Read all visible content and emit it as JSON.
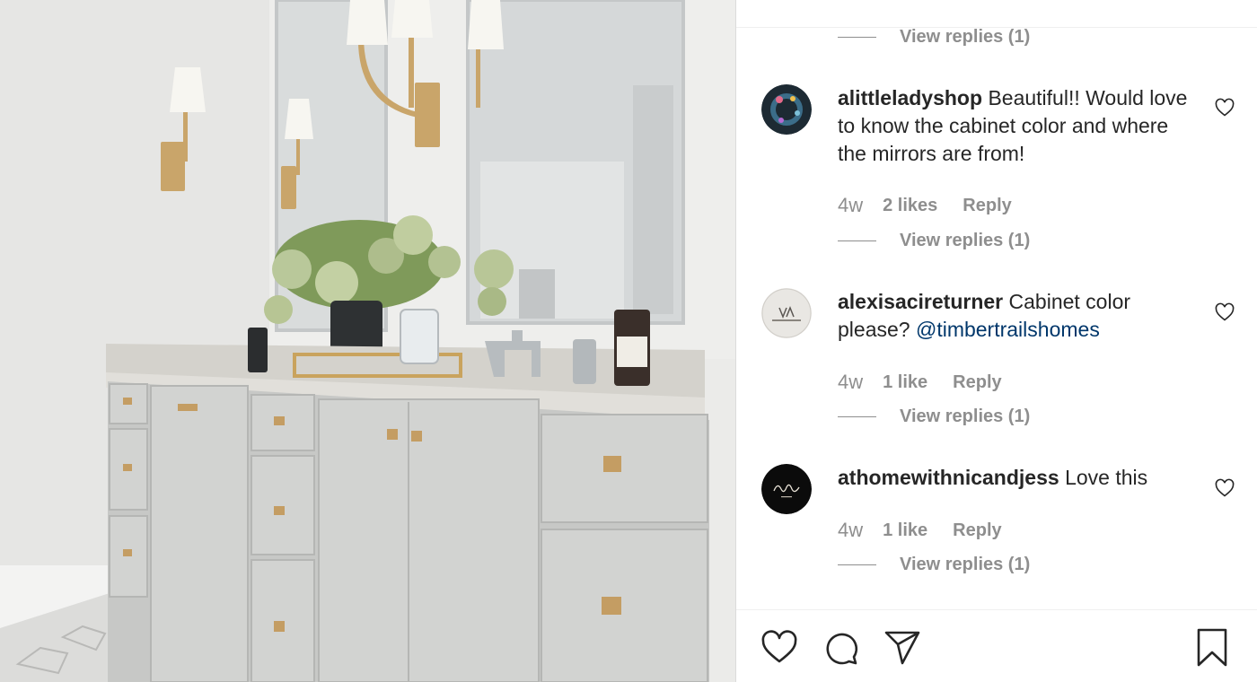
{
  "post": {
    "icons": {
      "like": "heart-icon",
      "comment": "comment-bubble-icon",
      "share": "paper-plane-icon",
      "save": "bookmark-icon",
      "comment_like": "heart-outline-icon"
    },
    "colors": {
      "text": "#262626",
      "muted": "#8e8e8e",
      "mention": "#00376b",
      "border": "#dbdbdb"
    }
  },
  "thread": {
    "top_replies_label": "View replies (1)",
    "comments": [
      {
        "username": "alittleladyshop",
        "text": "Beautiful!! Would love to know the cabinet color and where the mirrors are from!",
        "mention": "",
        "time": "4w",
        "likes": "2 likes",
        "reply_label": "Reply",
        "replies_label": "View replies (1)"
      },
      {
        "username": "alexisacireturner",
        "text": "Cabinet color please?",
        "mention": "@timbertrailshomes",
        "time": "4w",
        "likes": "1 like",
        "reply_label": "Reply",
        "replies_label": "View replies (1)"
      },
      {
        "username": "athomewithnicandjess",
        "text": "Love this",
        "mention": "",
        "time": "4w",
        "likes": "1 like",
        "reply_label": "Reply",
        "replies_label": "View replies (1)"
      }
    ]
  }
}
